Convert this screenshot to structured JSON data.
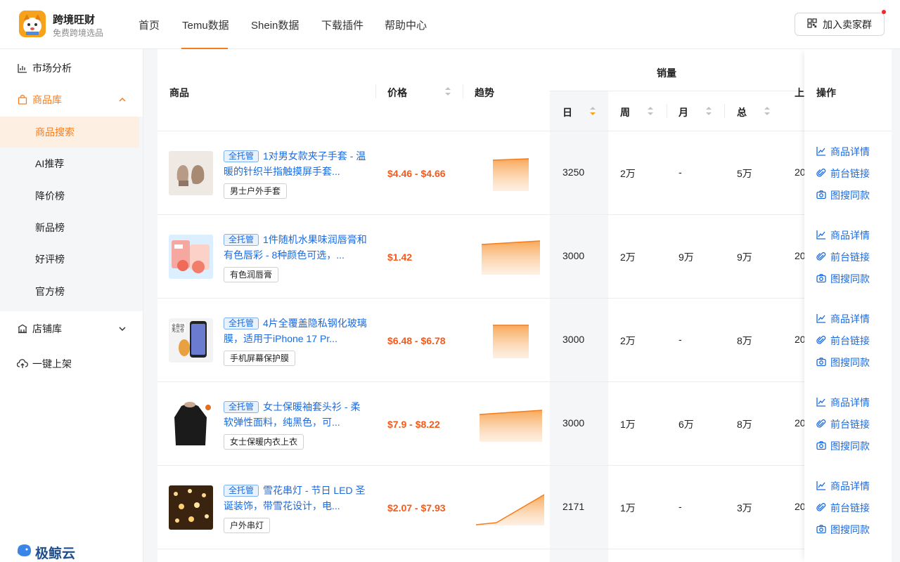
{
  "app": {
    "title": "跨境旺财",
    "subtitle": "免费跨境选品"
  },
  "nav": {
    "items": [
      {
        "label": "首页"
      },
      {
        "label": "Temu数据"
      },
      {
        "label": "Shein数据"
      },
      {
        "label": "下载插件"
      },
      {
        "label": "帮助中心"
      }
    ],
    "active": "Temu数据",
    "join_label": "加入卖家群"
  },
  "sidebar": {
    "market": "市场分析",
    "products": "商品库",
    "sub_items": [
      {
        "label": "商品搜索"
      },
      {
        "label": "AI推荐"
      },
      {
        "label": "降价榜"
      },
      {
        "label": "新品榜"
      },
      {
        "label": "好评榜"
      },
      {
        "label": "官方榜"
      }
    ],
    "active_sub": "商品搜索",
    "stores": "店铺库",
    "oneclick": "一键上架",
    "footer_brand": "极鲸云"
  },
  "table": {
    "headers": {
      "product": "商品",
      "price": "价格",
      "trend": "趋势",
      "sales": "销量",
      "day": "日",
      "week": "周",
      "month": "月",
      "total": "总",
      "listed": "上",
      "actions": "操作"
    },
    "badge": "全托管",
    "actions": {
      "detail": "商品详情",
      "link": "前台链接",
      "image_search": "图搜同款"
    },
    "rows": [
      {
        "name": "1对男女款夹子手套 - 温暖的针织半指触摸屏手套...",
        "tag": "男士户外手套",
        "price": "$4.46 - $4.66",
        "day": "3250",
        "week": "2万",
        "month": "-",
        "total": "5万",
        "listed": "20",
        "trend": [
          0.7,
          0.72,
          0.75
        ]
      },
      {
        "name": "1件随机水果味润唇膏和有色唇彩 - 8种颜色可选，...",
        "tag": "有色润唇膏",
        "price": "$1.42",
        "day": "3000",
        "week": "2万",
        "month": "9万",
        "total": "9万",
        "listed": "20",
        "trend": [
          0.72,
          0.76,
          0.8
        ]
      },
      {
        "name": "4片全覆盖隐私钢化玻璃膜，适用于iPhone 17 Pr...",
        "tag": "手机屏幕保护膜",
        "price": "$6.48 - $6.78",
        "day": "3000",
        "week": "2万",
        "month": "-",
        "total": "8万",
        "listed": "20",
        "trend": [
          0.7,
          0.7,
          0.7
        ]
      },
      {
        "name": "女士保暖袖套头衫 - 柔软弹性面料，纯黑色，可...",
        "tag": "女士保暖内衣上衣",
        "price": "$7.9 - $8.22",
        "day": "3000",
        "week": "1万",
        "month": "6万",
        "total": "8万",
        "listed": "20",
        "trend": [
          0.62,
          0.66,
          0.7
        ]
      },
      {
        "name": "雪花串灯 - 节日 LED 圣诞装饰，带雪花设计，电...",
        "tag": "户外串灯",
        "price": "$2.07 - $7.93",
        "day": "2171",
        "week": "1万",
        "month": "-",
        "total": "3万",
        "listed": "20",
        "trend": [
          0.05,
          0.1,
          0.7
        ]
      }
    ]
  },
  "colors": {
    "accent": "#f77c1c",
    "link": "#1a6be0",
    "price": "#f55a1b"
  }
}
